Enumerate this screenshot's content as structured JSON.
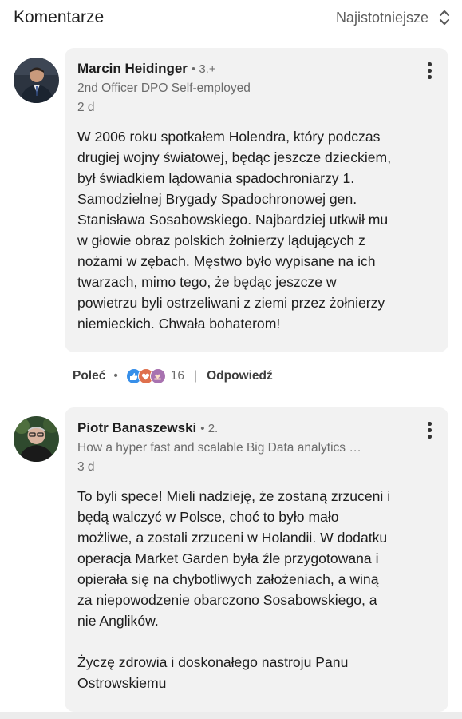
{
  "header": {
    "title": "Komentarze",
    "sort_label": "Najistotniejsze"
  },
  "comments": [
    {
      "name": "Marcin Heidinger",
      "degree": "• 3.+",
      "headline": "2nd Officer DPO Self-employed",
      "time": "2 d",
      "text": "W 2006 roku spotkałem Holendra, który podczas\ndrugiej wojny światowej, będąc jeszcze dzieckiem,\nbył świadkiem lądowania spadochroniarzy 1.\nSamodzielnej Brygady Spadochronowej gen.\nStanisława Sosabowskiego. Najbardziej utkwił mu\nw głowie obraz polskich żołnierzy lądujących z\nnożami w zębach. Męstwo było wypisane na ich\ntwarzach, mimo tego, że będąc jeszcze w\npowietrzu byli ostrzeliwani z ziemi przez żołnierzy\nniemieckich. Chwała bohaterom!",
      "like_label": "Poleć",
      "reaction_count": "16",
      "reply_label": "Odpowiedź",
      "reactions": [
        "like-reaction-icon",
        "love-reaction-icon",
        "support-reaction-icon"
      ]
    },
    {
      "name": "Piotr Banaszewski",
      "degree": "• 2.",
      "headline": "How a hyper fast and scalable Big Data analytics …",
      "time": "3 d",
      "text": "To byli spece! Mieli nadzieję, że zostaną zrzuceni i\nbędą walczyć w Polsce, choć to było mało\nmożliwe, a zostali zrzuceni w Holandii. W dodatku\noperacja Market Garden była źle przygotowana i\nopierała się na chybotliwych założeniach, a winą\nza niepowodzenie obarczono Sosabowskiego, a\nnie Anglików.\n\nŻyczę zdrowia i doskonałego nastroju Panu\nOstrowskiemu"
    }
  ],
  "colors": {
    "bubble": "#f2f2f2",
    "muted": "#6b6b6b",
    "like_blue": "#378fe9",
    "love_red": "#df704d",
    "support_purple": "#a872b0"
  }
}
